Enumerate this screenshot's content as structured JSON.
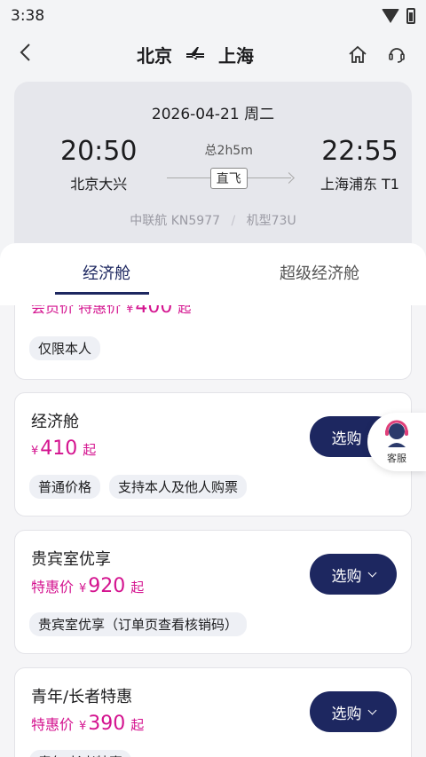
{
  "status": {
    "time": "3:38"
  },
  "header": {
    "from": "北京",
    "to": "上海"
  },
  "flight": {
    "date": "2026-04-21 周二",
    "dep_time": "20:50",
    "dep_airport": "北京大兴",
    "arr_time": "22:55",
    "arr_airport": "上海浦东 T1",
    "duration": "总2h5m",
    "direct": "直飞",
    "airline_info": "中联航 KN5977",
    "separator": "/",
    "aircraft": "机型73U"
  },
  "tabs": [
    {
      "label": "经济舱",
      "active": true
    },
    {
      "label": "超级经济舱",
      "active": false
    }
  ],
  "cards": [
    {
      "name": "",
      "price_label": "会员价 特惠价",
      "currency": "¥",
      "price": "400",
      "suffix": "起",
      "tags": [
        "仅限本人"
      ]
    },
    {
      "name": "经济舱",
      "price_label": "",
      "currency": "¥",
      "price": "410",
      "suffix": "起",
      "tags": [
        "普通价格",
        "支持本人及他人购票"
      ],
      "button": "选购"
    },
    {
      "name": "贵宾室优享",
      "price_label": "特惠价",
      "currency": "¥",
      "price": "920",
      "suffix": "起",
      "tags": [
        "贵宾室优享（订单页查看核销码）"
      ],
      "button": "选购"
    },
    {
      "name": "青年/长者特惠",
      "price_label": "特惠价",
      "currency": "¥",
      "price": "390",
      "suffix": "起",
      "tags": [
        "青年/长者特惠"
      ],
      "button": "选购"
    }
  ],
  "customer_service": {
    "label": "客服"
  },
  "colors": {
    "navy": "#1d2760",
    "price": "#d4138f"
  }
}
